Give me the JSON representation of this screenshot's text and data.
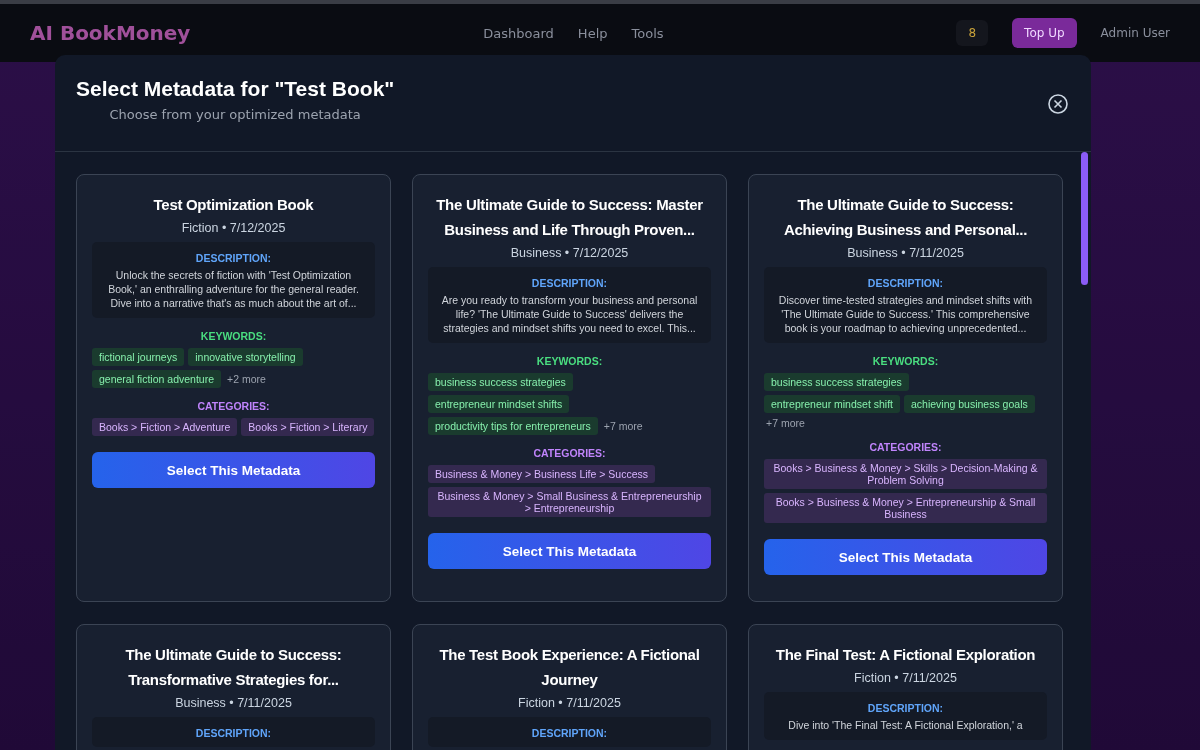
{
  "background_page": {
    "brand": "AI BookMoney",
    "nav_links": [
      "Dashboard",
      "Help",
      "Tools"
    ],
    "credits": "8",
    "top_up": "Top Up",
    "user": "Admin User"
  },
  "modal": {
    "title": "Select Metadata for \"Test Book\"",
    "subtitle": "Choose from your optimized metadata",
    "cards": [
      {
        "title": "Test Optimization Book",
        "meta": "Fiction • 7/12/2025",
        "description_label": "DESCRIPTION:",
        "description": "Unlock the secrets of fiction with 'Test Optimization Book,' an enthralling adventure for the general reader. Dive into a narrative that's as much about the art of...",
        "keywords_label": "KEYWORDS:",
        "keywords": [
          "fictional journeys",
          "innovative storytelling",
          "general fiction adventure"
        ],
        "more": "+2 more",
        "categories_label": "CATEGORIES:",
        "categories": [
          "Books > Fiction > Adventure",
          "Books > Fiction > Literary"
        ],
        "button": "Select This Metadata"
      },
      {
        "title": "The Ultimate Guide to Success: Master Business and Life Through Proven...",
        "meta": "Business • 7/12/2025",
        "description_label": "DESCRIPTION:",
        "description": "Are you ready to transform your business and personal life? 'The Ultimate Guide to Success' delivers the strategies and mindset shifts you need to excel. This...",
        "keywords_label": "KEYWORDS:",
        "keywords": [
          "business success strategies",
          "entrepreneur mindset shifts",
          "productivity tips for entrepreneurs"
        ],
        "more": "+7 more",
        "categories_label": "CATEGORIES:",
        "categories": [
          "Business & Money > Business Life > Success",
          "Business & Money > Small Business & Entrepreneurship > Entrepreneurship"
        ],
        "button": "Select This Metadata"
      },
      {
        "title": "The Ultimate Guide to Success: Achieving Business and Personal...",
        "meta": "Business • 7/11/2025",
        "description_label": "DESCRIPTION:",
        "description": "Discover time-tested strategies and mindset shifts with 'The Ultimate Guide to Success.' This comprehensive book is your roadmap to achieving unprecedented...",
        "keywords_label": "KEYWORDS:",
        "keywords": [
          "business success strategies",
          "entrepreneur mindset shift",
          "achieving business goals"
        ],
        "more": "+7 more",
        "categories_label": "CATEGORIES:",
        "categories": [
          "Books > Business & Money > Skills > Decision-Making & Problem Solving",
          "Books > Business & Money > Entrepreneurship & Small Business"
        ],
        "button": "Select This Metadata"
      },
      {
        "title": "The Ultimate Guide to Success: Transformative Strategies for...",
        "meta": "Business • 7/11/2025",
        "description_label": "DESCRIPTION:"
      },
      {
        "title": "The Test Book Experience: A Fictional Journey",
        "meta": "Fiction • 7/11/2025",
        "description_label": "DESCRIPTION:"
      },
      {
        "title": "The Final Test: A Fictional Exploration",
        "meta": "Fiction • 7/11/2025",
        "description_label": "DESCRIPTION:",
        "description": "Dive into 'The Final Test: A Fictional Exploration,' a"
      }
    ]
  }
}
